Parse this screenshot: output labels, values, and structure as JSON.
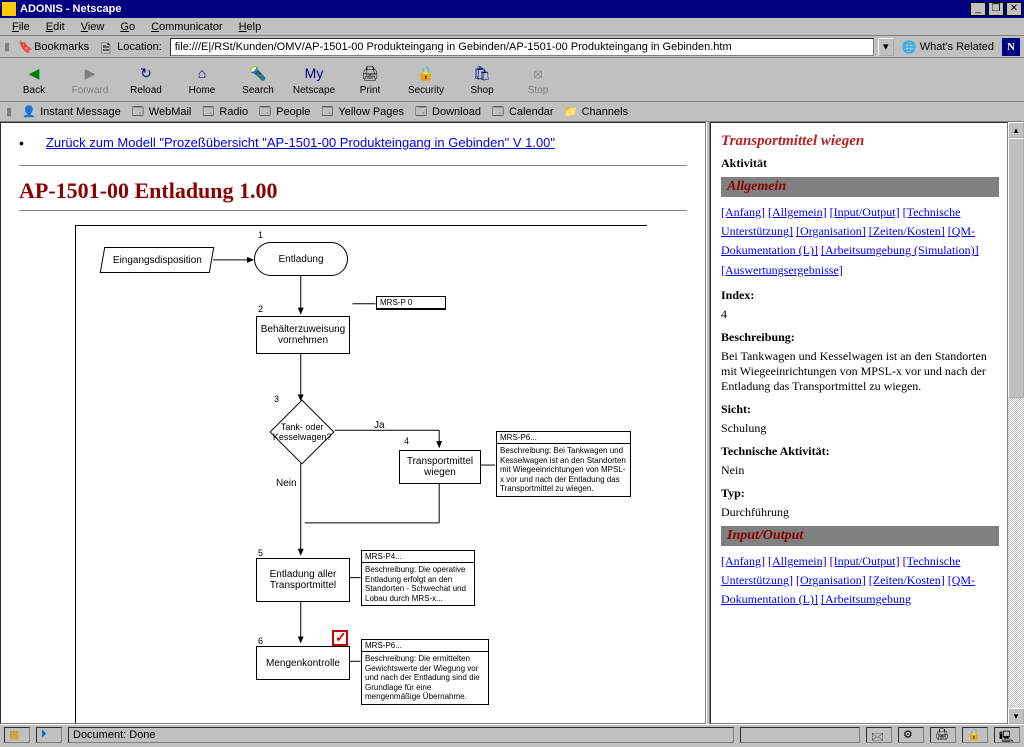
{
  "window": {
    "title": "ADONIS - Netscape"
  },
  "menubar": [
    "File",
    "Edit",
    "View",
    "Go",
    "Communicator",
    "Help"
  ],
  "location": {
    "bookmarks": "Bookmarks",
    "label": "Location:",
    "url": "file:///E|/RSt/Kunden/OMV/AP-1501-00 Produkteingang in Gebinden/AP-1501-00 Produkteingang in Gebinden.htm",
    "related": "What's Related"
  },
  "toolbar": [
    {
      "key": "back",
      "label": "Back",
      "icon": "◀",
      "color": "#008000"
    },
    {
      "key": "forward",
      "label": "Forward",
      "icon": "▶",
      "color": "#808080",
      "disabled": true
    },
    {
      "key": "reload",
      "label": "Reload",
      "icon": "↻",
      "color": "#000080"
    },
    {
      "key": "home",
      "label": "Home",
      "icon": "⌂",
      "color": "#000080"
    },
    {
      "key": "search",
      "label": "Search",
      "icon": "🔦",
      "color": "#000"
    },
    {
      "key": "netscape",
      "label": "Netscape",
      "icon": "My",
      "color": "#000080"
    },
    {
      "key": "print",
      "label": "Print",
      "icon": "🖨",
      "color": "#000"
    },
    {
      "key": "security",
      "label": "Security",
      "icon": "🔒",
      "color": "#000080"
    },
    {
      "key": "shop",
      "label": "Shop",
      "icon": "🛍",
      "color": "#000080"
    },
    {
      "key": "stop",
      "label": "Stop",
      "icon": "⦻",
      "color": "#808080",
      "disabled": true
    }
  ],
  "quicklinks": [
    {
      "key": "im",
      "label": "Instant Message",
      "icon": "👤"
    },
    {
      "key": "webmail",
      "label": "WebMail",
      "icon": "🗔"
    },
    {
      "key": "radio",
      "label": "Radio",
      "icon": "🗔"
    },
    {
      "key": "people",
      "label": "People",
      "icon": "🗔"
    },
    {
      "key": "yellow",
      "label": "Yellow Pages",
      "icon": "🗔"
    },
    {
      "key": "download",
      "label": "Download",
      "icon": "🗔"
    },
    {
      "key": "calendar",
      "label": "Calendar",
      "icon": "🗔"
    },
    {
      "key": "channels",
      "label": "Channels",
      "icon": "📁"
    }
  ],
  "page": {
    "backlink": "Zurück zum Modell \"Prozeßübersicht \"AP-1501-00 Produkteingang in Gebinden\" V 1.00\"",
    "heading": "AP-1501-00 Entladung 1.00"
  },
  "diagram": {
    "nodes": {
      "start": "Eingangsdisposition",
      "entladung": "Entladung",
      "behaelter": "Behälterzuweisung vornehmen",
      "decision": "Tank- oder Kesselwagen?",
      "transport": "Transportmittel wiegen",
      "entladung_aller": "Entladung aller Transportmittel",
      "mengen": "Mengenkontrolle"
    },
    "edges": {
      "ja": "Ja",
      "nein": "Nein"
    },
    "seq": {
      "s1": "1",
      "s2": "2",
      "s3": "3",
      "s4": "4",
      "s5": "5",
      "s6": "6"
    },
    "annot": {
      "a1_title": "MRS-P 0",
      "a2_title": "MRS-P6...",
      "a2_body": "Beschreibung:\nBei Tankwagen und Kesselwagen ist an den Standorten mit Wiegeeinrichtungen von MPSL-x vor und nach der Entladung das Transportmittel zu wiegen.",
      "a3_title": "MRS-P4...",
      "a3_body": "Beschreibung:\nDie operative Entladung erfolgt an den Standorten\n- Schwechat und Lobau durch MRS-x...",
      "a4_title": "MRS-P6...",
      "a4_body": "Beschreibung:\nDie ermittelten Gewichtswerte der Wiegung vor und nach der Entladung sind die Grundlage für eine mengenmäßige Übernahme."
    }
  },
  "right": {
    "title": "Transportmittel wiegen",
    "activity_label": "Aktivität",
    "sec_general": "Allgemein",
    "navlinks": [
      "[Anfang]",
      "[Allgemein]",
      "[Input/Output]",
      "[Technische Unterstützung]",
      "[Organisation]",
      "[Zeiten/Kosten]",
      "[QM-Dokumentation (L)]",
      "[Arbeitsumgebung (Simulation)]",
      "[Auswertungsergebnisse]"
    ],
    "idx_label": "Index:",
    "idx_val": "4",
    "desc_label": "Beschreibung:",
    "desc_val": "Bei Tankwagen und Kesselwagen ist an den Standorten mit Wiegeeinrichtungen von MPSL-x vor und nach der Entladung das Transportmittel zu wiegen.",
    "sicht_label": "Sicht:",
    "sicht_val": "Schulung",
    "tech_label": "Technische Aktivität:",
    "tech_val": "Nein",
    "typ_label": "Typ:",
    "typ_val": "Durchführung",
    "sec_io": "Input/Output",
    "navlinks2": [
      "[Anfang]",
      "[Allgemein]",
      "[Input/Output]",
      "[Technische Unterstützung]",
      "[Organisation]",
      "[Zeiten/Kosten]",
      "[QM-Dokumentation (L)]",
      "[Arbeitsumgebung"
    ]
  },
  "status": {
    "done": "Document: Done"
  }
}
